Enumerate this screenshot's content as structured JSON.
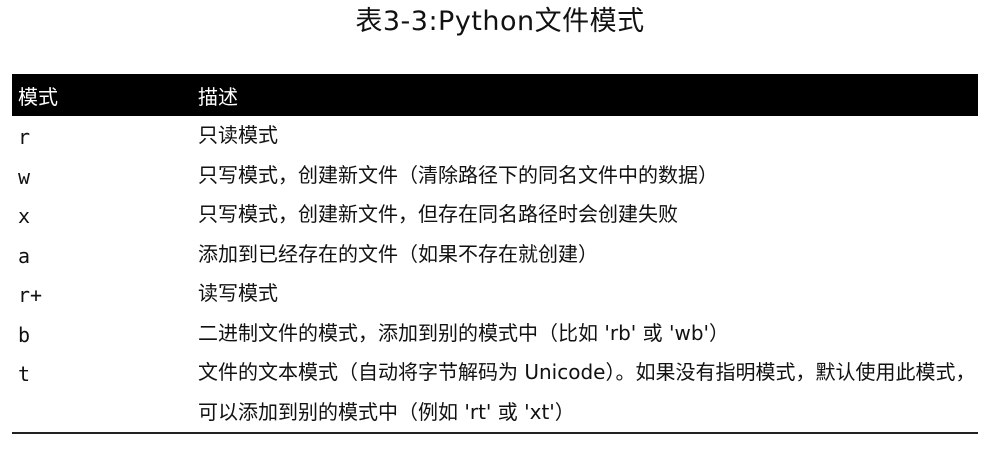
{
  "title": "表3-3:Python文件模式",
  "header": {
    "mode": "模式",
    "description": "描述"
  },
  "rows": [
    {
      "mode": "r",
      "description": "只读模式"
    },
    {
      "mode": "w",
      "description": "只写模式，创建新文件（清除路径下的同名文件中的数据）"
    },
    {
      "mode": "x",
      "description": "只写模式，创建新文件，但存在同名路径时会创建失败"
    },
    {
      "mode": "a",
      "description": "添加到已经存在的文件（如果不存在就创建）"
    },
    {
      "mode": "r+",
      "description": "读写模式"
    },
    {
      "mode": "b",
      "description": "二进制文件的模式，添加到别的模式中（比如 'rb' 或 'wb'）"
    },
    {
      "mode": "t",
      "description": "文件的文本模式（自动将字节解码为 Unicode）。如果没有指明模式，默认使用此模式，可以添加到别的模式中（例如 'rt' 或 'xt'）"
    }
  ]
}
